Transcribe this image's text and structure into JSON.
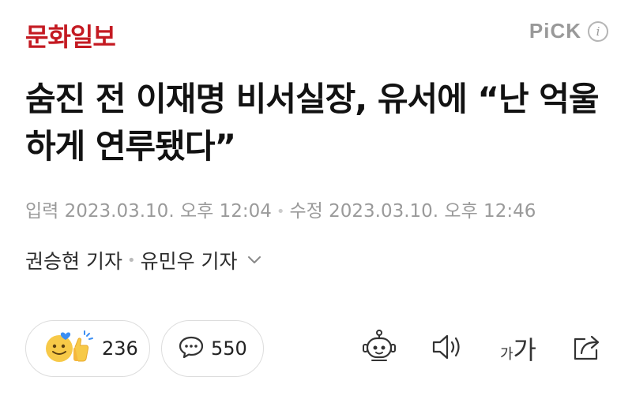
{
  "publisher": {
    "name": "문화일보"
  },
  "badge": {
    "pick_label": "PiCK",
    "info_glyph": "i"
  },
  "article": {
    "headline": "숨진 전 이재명 비서실장, 유서에 “난 억울하게 연루됐다”",
    "published": "입력 2023.03.10. 오후 12:04",
    "modified": "수정 2023.03.10. 오후 12:46",
    "separator": "•",
    "authors": [
      "권승현 기자",
      "유민우 기자"
    ]
  },
  "actions": {
    "reaction_count": "236",
    "comment_count": "550",
    "font_size_small": "가",
    "font_size_big": "가"
  },
  "colors": {
    "brand": "#c41a22",
    "muted_text": "#9a9a9a",
    "pill_border": "#dddddd",
    "icon_stroke": "#333333"
  },
  "icons": [
    "info-icon",
    "emoji-reaction-icon",
    "comment-icon",
    "robot-summary-icon",
    "speaker-icon",
    "font-size-icon",
    "share-icon",
    "chevron-down-icon"
  ]
}
